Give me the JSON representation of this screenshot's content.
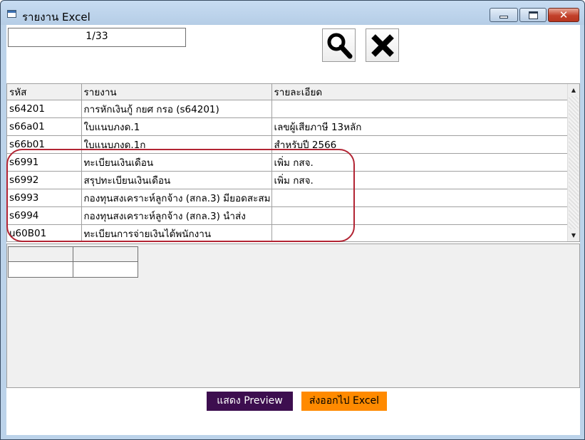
{
  "window": {
    "title": "รายงาน Excel"
  },
  "toolbar": {
    "page_indicator": "1/33"
  },
  "table": {
    "columns": [
      "รหัส",
      "รายงาน",
      "รายละเอียด"
    ],
    "rows": [
      [
        "s64201",
        "การหักเงินกู้ กยศ กรอ (s64201)",
        ""
      ],
      [
        "s66a01",
        "ใบแนบภงด.1",
        "เลขผู้เสียภาษี 13หลัก"
      ],
      [
        "s66b01",
        "ใบแนบภงด.1ก",
        "สำหรับปี 2566"
      ],
      [
        "s6991",
        "ทะเบียนเงินเดือน",
        "เพิ่ม กสจ."
      ],
      [
        "s6992",
        "สรุปทะเบียนเงินเดือน",
        "เพิ่ม กสจ."
      ],
      [
        "s6993",
        "กองทุนสงเคราะห์ลูกจ้าง (สกล.3) มียอดสะสม",
        ""
      ],
      [
        "s6994",
        "กองทุนสงเคราะห์ลูกจ้าง (สกล.3) นำส่ง",
        ""
      ],
      [
        "u60B01",
        "ทะเบียนการจ่ายเงินได้พนักงาน",
        ""
      ]
    ]
  },
  "buttons": {
    "preview": "แสดง Preview",
    "export_excel": "ส่งออกไป Excel"
  },
  "colors": {
    "highlight": "#b22433",
    "preview_bg": "#3d0e4f",
    "excel_bg": "#ff8a00"
  }
}
